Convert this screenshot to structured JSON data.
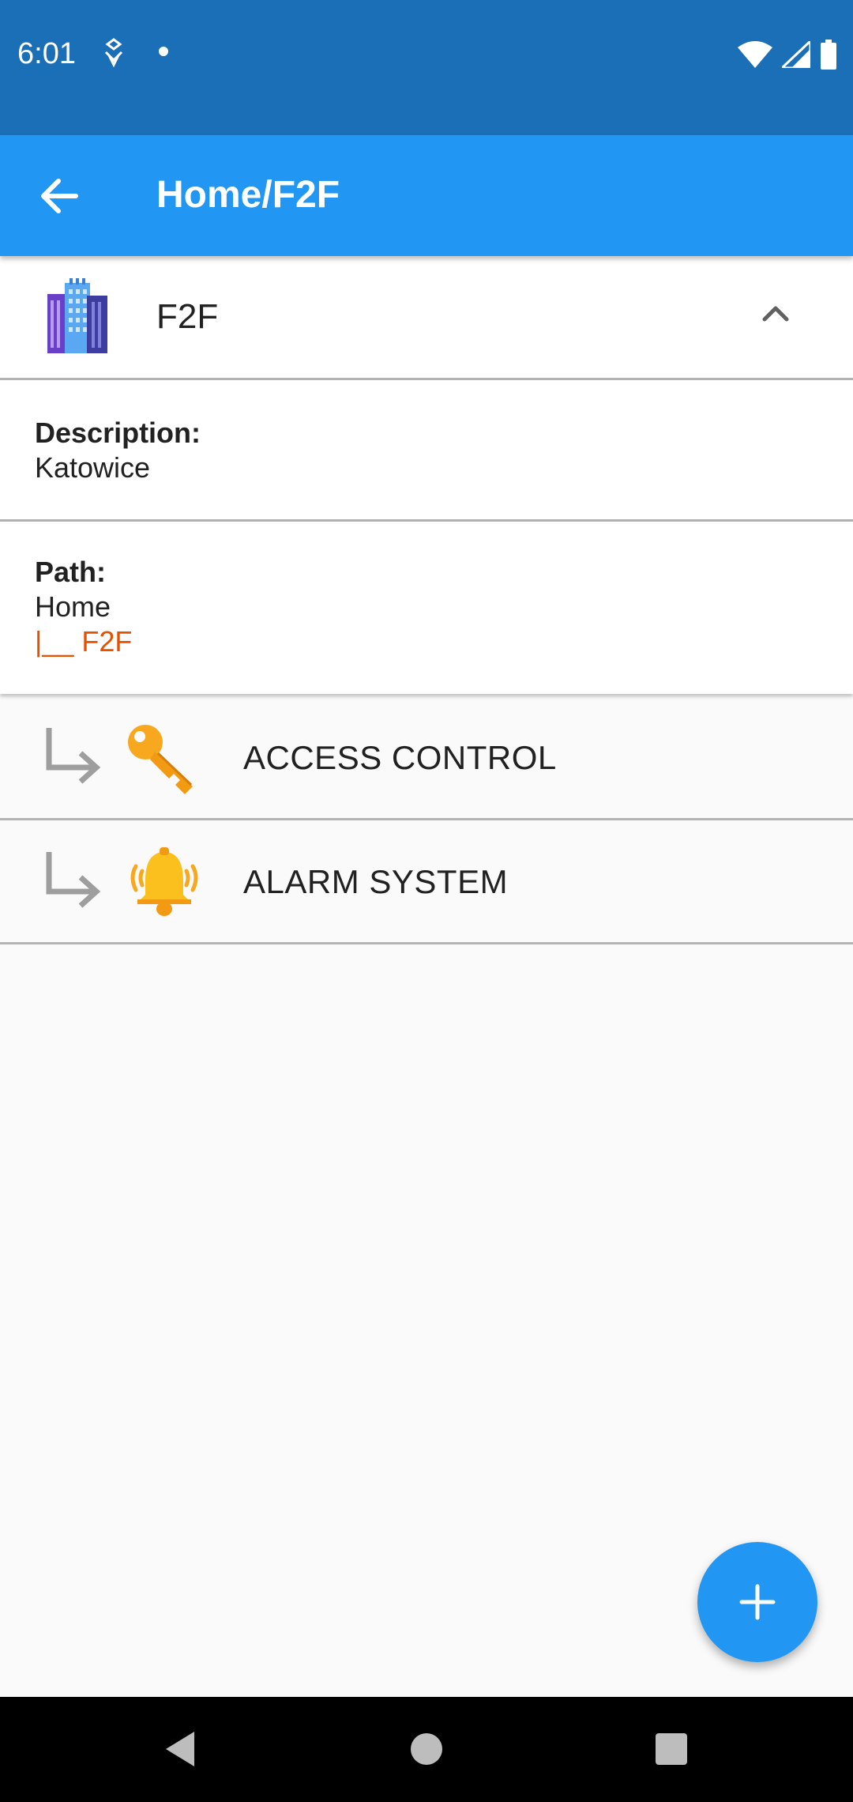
{
  "status_bar": {
    "time": "6:01",
    "left_icons": [
      "notification-icon",
      "dot-icon"
    ],
    "right_icons": [
      "wifi-icon",
      "signal-icon",
      "battery-icon"
    ]
  },
  "app_bar": {
    "title": "Home/F2F",
    "back_icon": "arrow-back-icon",
    "color": "#2196f3"
  },
  "header": {
    "name": "F2F",
    "icon": "building-icon",
    "toggle_icon": "chevron-up-icon"
  },
  "description": {
    "label": "Description:",
    "value": "Katowice"
  },
  "path": {
    "label": "Path:",
    "root": "Home",
    "leaf": "|__ F2F",
    "leaf_color": "#e65100"
  },
  "items": [
    {
      "label": "ACCESS CONTROL",
      "icon": "key-icon"
    },
    {
      "label": "ALARM SYSTEM",
      "icon": "alarm-bell-icon"
    }
  ],
  "fab": {
    "icon": "plus-icon"
  },
  "nav_bar": {
    "buttons": [
      "back-nav-icon",
      "home-nav-icon",
      "recents-nav-icon"
    ]
  }
}
